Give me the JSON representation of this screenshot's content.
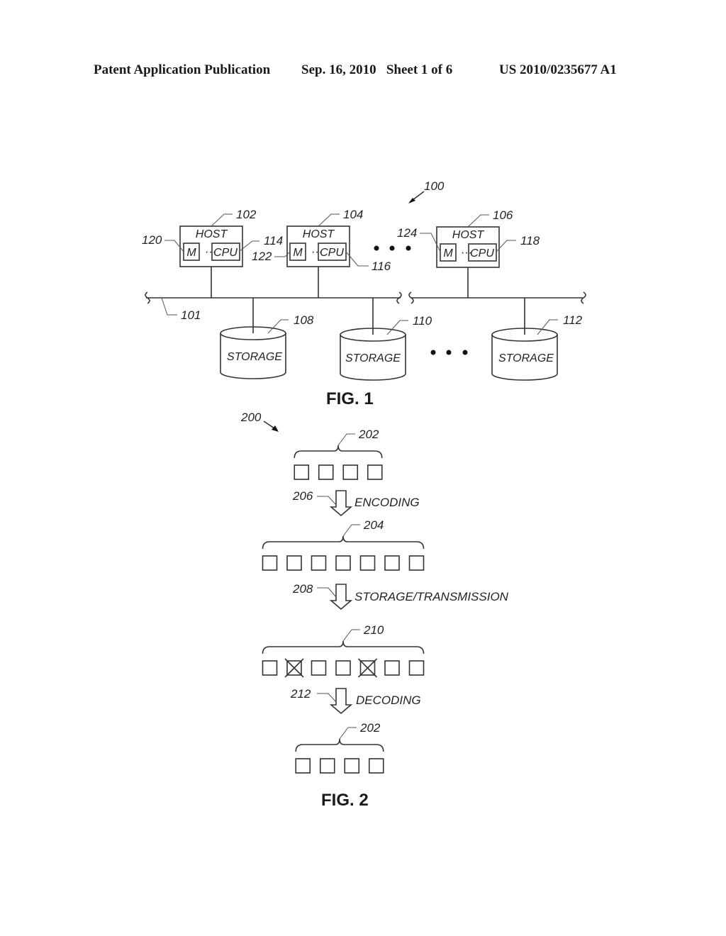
{
  "header": {
    "publication": "Patent Application Publication",
    "date_sheet": "Sep. 16, 2010   Sheet 1 of 6",
    "number": "US 2010/0235677 A1"
  },
  "fig1": {
    "caption": "FIG. 1",
    "system_ref": "100",
    "bus_ref": "101",
    "hosts": [
      {
        "ref": "102",
        "label": "HOST",
        "mem_label": "M",
        "cpu_label": "CPU",
        "mem_ref": "120",
        "cpu_ref": "114"
      },
      {
        "ref": "104",
        "label": "HOST",
        "mem_label": "M",
        "cpu_label": "CPU",
        "mem_ref": "122",
        "cpu_ref": "116"
      },
      {
        "ref": "106",
        "label": "HOST",
        "mem_label": "M",
        "cpu_label": "CPU",
        "mem_ref": "124",
        "cpu_ref": "118"
      }
    ],
    "storages": [
      {
        "ref": "108",
        "label": "STORAGE"
      },
      {
        "ref": "110",
        "label": "STORAGE"
      },
      {
        "ref": "112",
        "label": "STORAGE"
      }
    ]
  },
  "fig2": {
    "caption": "FIG. 2",
    "process_ref": "200",
    "original": {
      "ref": "202",
      "count": 4
    },
    "encoded": {
      "ref": "204",
      "count": 7
    },
    "received": {
      "ref": "210",
      "count": 7,
      "erased_indices": [
        1,
        4
      ]
    },
    "decoded": {
      "ref": "202",
      "count": 4
    },
    "steps": [
      {
        "ref": "206",
        "label": "ENCODING"
      },
      {
        "ref": "208",
        "label": "STORAGE/TRANSMISSION"
      },
      {
        "ref": "212",
        "label": "DECODING"
      }
    ]
  }
}
